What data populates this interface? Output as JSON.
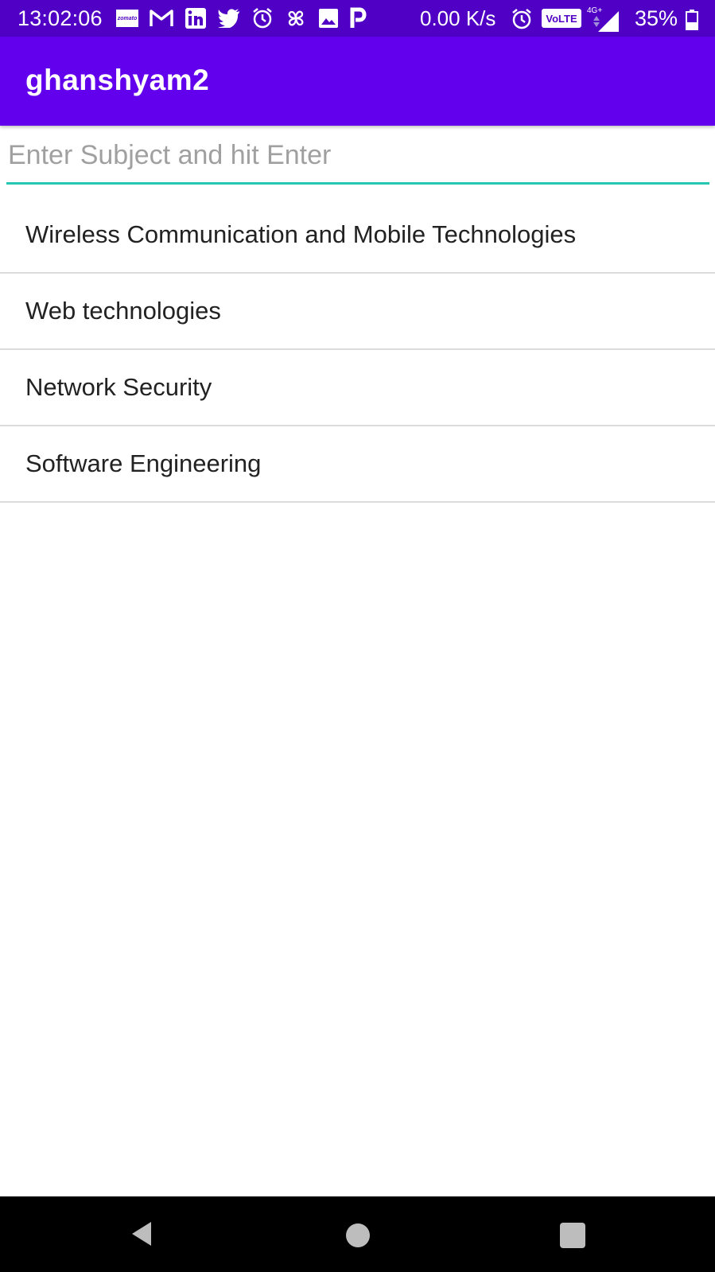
{
  "status_bar": {
    "time": "13:02:06",
    "notification_icons": [
      "zomato-icon",
      "gmail-icon",
      "linkedin-icon",
      "twitter-icon",
      "alarm-icon",
      "pinwheel-icon",
      "gallery-icon",
      "paytm-icon"
    ],
    "zomato_text": "zomato",
    "net_speed": "0.00 K/s",
    "volte": "VoLTE",
    "network_type": "4G+",
    "battery": "35%"
  },
  "app_bar": {
    "title": "ghanshyam2",
    "color": "#6200ee"
  },
  "subject_input": {
    "placeholder": "Enter Subject and hit Enter",
    "value": "",
    "underline_color": "#26c6b0"
  },
  "subjects": [
    "Wireless Communication and Mobile Technologies",
    "Web technologies",
    "Network Security",
    "Software Engineering"
  ],
  "nav_bar": {
    "buttons": [
      "back-icon",
      "home-icon",
      "recents-icon"
    ]
  }
}
